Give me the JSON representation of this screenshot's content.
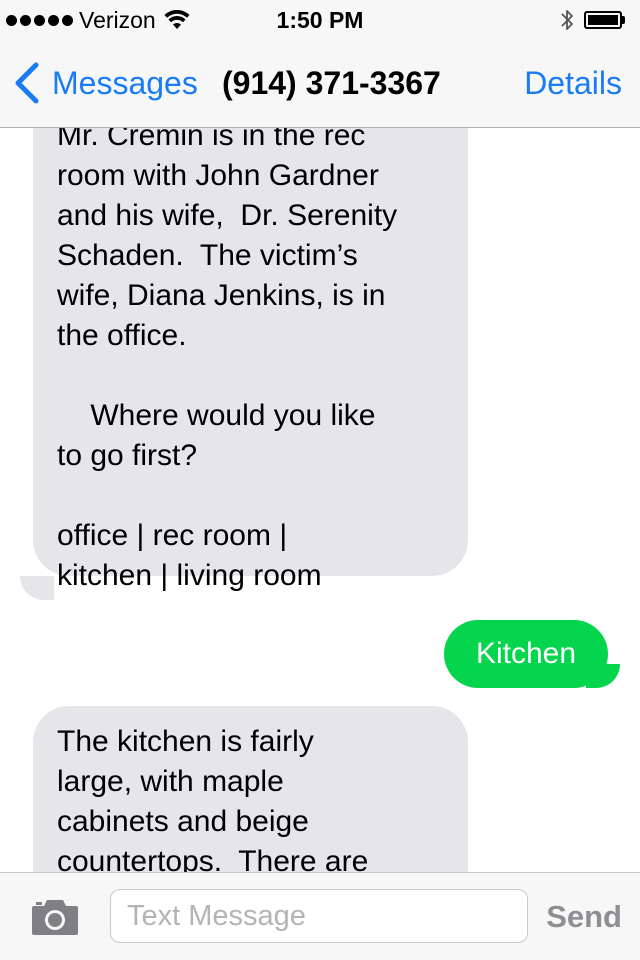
{
  "status_bar": {
    "carrier": "Verizon",
    "time": "1:50 PM",
    "signal_bars": 5,
    "battery_level": 1.0,
    "icons": [
      "signal-dots-icon",
      "wifi-icon",
      "bluetooth-icon",
      "battery-icon"
    ]
  },
  "nav": {
    "back_label": "Messages",
    "title": "(914) 371-3367",
    "details_label": "Details"
  },
  "messages": [
    {
      "direction": "incoming",
      "text": "Mr. Cremin is in the rec\nroom with John Gardner\nand his wife,  Dr. Serenity\nSchaden.  The victim’s\nwife, Diana Jenkins, is in\nthe office.\n\n    Where would you like\nto go first?\n\noffice | rec room |\nkitchen | living room"
    },
    {
      "direction": "outgoing",
      "text": "Kitchen"
    },
    {
      "direction": "incoming",
      "text": "The kitchen is fairly\nlarge, with maple\ncabinets and beige\ncountertops.  There are"
    }
  ],
  "input": {
    "placeholder": "Text Message",
    "value": "",
    "send_label": "Send"
  },
  "colors": {
    "ios_blue": "#1a7cf5",
    "incoming_bubble": "#e5e5ea",
    "outgoing_bubble": "#05d54c",
    "bar_background": "#f7f7f7",
    "send_disabled": "#8e8e93"
  }
}
